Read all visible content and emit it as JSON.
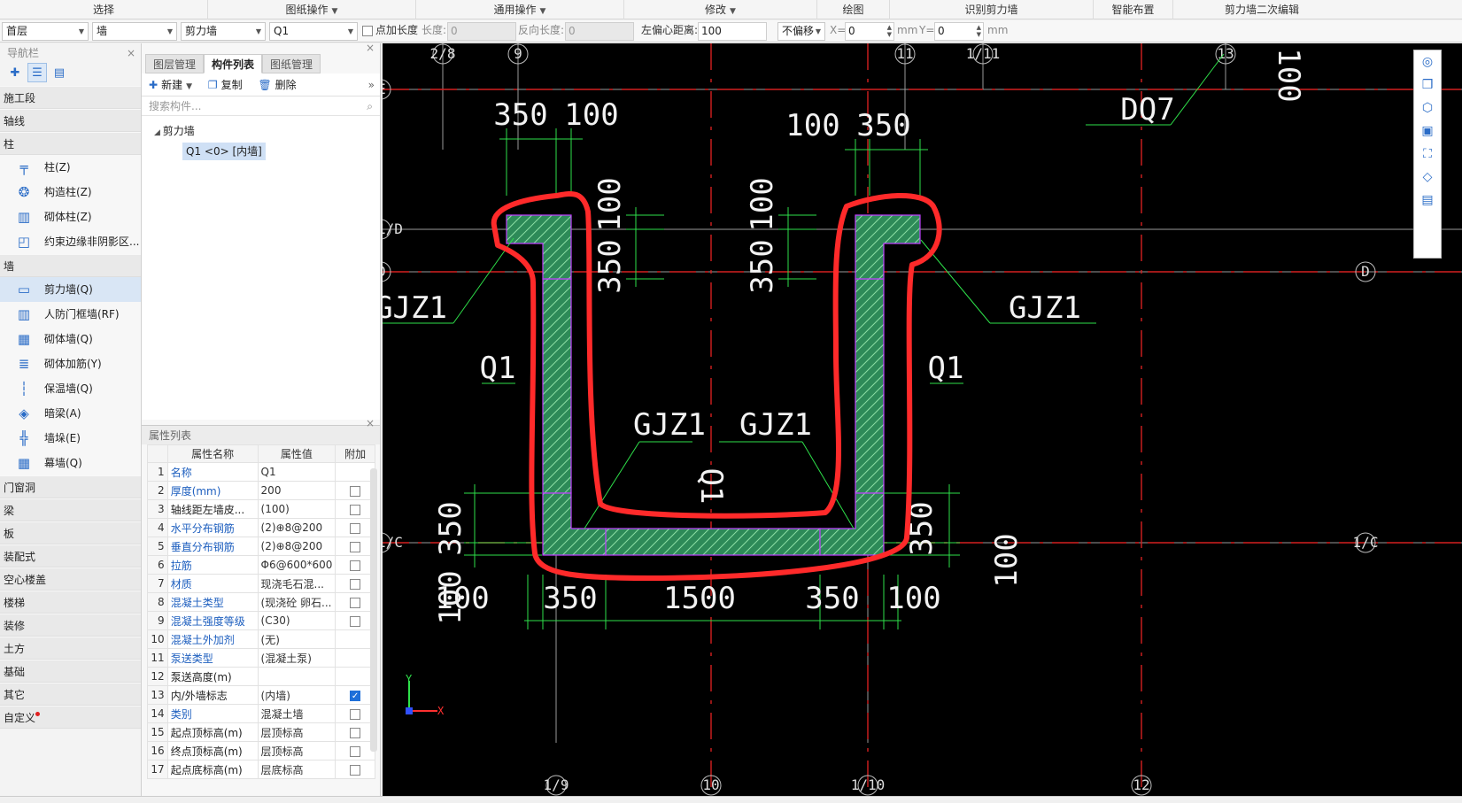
{
  "ribbon": {
    "groups": [
      {
        "label": "选择",
        "has_caret": false
      },
      {
        "label": "图纸操作",
        "has_caret": true
      },
      {
        "label": "通用操作",
        "has_caret": true
      },
      {
        "label": "修改",
        "has_caret": true
      },
      {
        "label": "绘图",
        "has_caret": false
      },
      {
        "label": "识别剪力墙",
        "has_caret": false
      },
      {
        "label": "智能布置",
        "has_caret": false
      },
      {
        "label": "剪力墙二次编辑",
        "has_caret": false
      }
    ]
  },
  "toolbar": {
    "floor": "首层",
    "category": "墙",
    "type": "剪力墙",
    "component": "Q1",
    "add_length_label": "点加长度",
    "length_label": "长度:",
    "length_value": "0",
    "reverse_length_label": "反向长度:",
    "reverse_length_value": "0",
    "offset_label": "左偏心距离:",
    "offset_value": "100",
    "shift_option": "不偏移",
    "x_label": "X=",
    "x_value": "0",
    "unit_mm": "mm",
    "y_label": "Y=",
    "y_value": "0"
  },
  "nav": {
    "title": "导航栏",
    "close": "×",
    "categories": {
      "construction": "施工段",
      "axis": "轴线",
      "column": "柱",
      "wall": "墙",
      "openings": "门窗洞",
      "beam": "梁",
      "slab": "板",
      "prefab": "装配式",
      "hollow": "空心楼盖",
      "stair": "楼梯",
      "decor": "装修",
      "earth": "土方",
      "foundation": "基础",
      "other": "其它",
      "custom": "自定义"
    },
    "column_items": [
      "柱(Z)",
      "构造柱(Z)",
      "砌体柱(Z)",
      "约束边缘非阴影区..."
    ],
    "wall_items": [
      "剪力墙(Q)",
      "人防门框墙(RF)",
      "砌体墙(Q)",
      "砌体加筋(Y)",
      "保温墙(Q)",
      "暗梁(A)",
      "墙垛(E)",
      "幕墙(Q)"
    ]
  },
  "mid": {
    "tabs": [
      "图层管理",
      "构件列表",
      "图纸管理"
    ],
    "actions": {
      "new": "新建",
      "copy": "复制",
      "delete": "删除"
    },
    "search_placeholder": "搜索构件...",
    "tree_root": "剪力墙",
    "tree_leaf": "Q1 <0> [内墙]",
    "props_title": "属性列表",
    "props_headers": {
      "name": "属性名称",
      "value": "属性值",
      "extra": "附加"
    },
    "props": [
      {
        "i": "1",
        "n": "名称",
        "v": "Q1",
        "blue": true,
        "cb": false,
        "show_cb": false
      },
      {
        "i": "2",
        "n": "厚度(mm)",
        "v": "200",
        "blue": true,
        "cb": false,
        "show_cb": true
      },
      {
        "i": "3",
        "n": "轴线距左墙皮...",
        "v": "(100)",
        "blue": false,
        "cb": false,
        "show_cb": true
      },
      {
        "i": "4",
        "n": "水平分布钢筋",
        "v": "(2)⊕8@200",
        "blue": true,
        "cb": false,
        "show_cb": true
      },
      {
        "i": "5",
        "n": "垂直分布钢筋",
        "v": "(2)⊕8@200",
        "blue": true,
        "cb": false,
        "show_cb": true
      },
      {
        "i": "6",
        "n": "拉筋",
        "v": "Φ6@600*600",
        "blue": true,
        "cb": false,
        "show_cb": true
      },
      {
        "i": "7",
        "n": "材质",
        "v": "现浇毛石混...",
        "blue": true,
        "cb": false,
        "show_cb": true
      },
      {
        "i": "8",
        "n": "混凝土类型",
        "v": "(现浇砼 卵石...",
        "blue": true,
        "cb": false,
        "show_cb": true
      },
      {
        "i": "9",
        "n": "混凝土强度等级",
        "v": "(C30)",
        "blue": true,
        "cb": false,
        "show_cb": true
      },
      {
        "i": "10",
        "n": "混凝土外加剂",
        "v": "(无)",
        "blue": true,
        "cb": false,
        "show_cb": false
      },
      {
        "i": "11",
        "n": "泵送类型",
        "v": "(混凝土泵)",
        "blue": true,
        "cb": false,
        "show_cb": false
      },
      {
        "i": "12",
        "n": "泵送高度(m)",
        "v": "",
        "blue": false,
        "cb": false,
        "show_cb": false
      },
      {
        "i": "13",
        "n": "内/外墙标志",
        "v": "(内墙)",
        "blue": false,
        "cb": true,
        "show_cb": true
      },
      {
        "i": "14",
        "n": "类别",
        "v": "混凝土墙",
        "blue": true,
        "cb": false,
        "show_cb": true
      },
      {
        "i": "15",
        "n": "起点顶标高(m)",
        "v": "层顶标高",
        "blue": false,
        "cb": false,
        "show_cb": true
      },
      {
        "i": "16",
        "n": "终点顶标高(m)",
        "v": "层顶标高",
        "blue": false,
        "cb": false,
        "show_cb": true
      },
      {
        "i": "17",
        "n": "起点底标高(m)",
        "v": "层底标高",
        "blue": false,
        "cb": false,
        "show_cb": true
      }
    ]
  },
  "drawing": {
    "axes_top": [
      "2/8",
      "9",
      "11",
      "1/11",
      "13"
    ],
    "axes_bottom": [
      "1/9",
      "10",
      "1/10",
      "12"
    ],
    "axes_left": [
      "E",
      "1/D",
      "D",
      "1/C"
    ],
    "axes_right": [
      "D",
      "1/C"
    ],
    "dims_top_left": [
      "350",
      "100"
    ],
    "dims_top_right": [
      "100",
      "350"
    ],
    "dims_bottom": [
      "100",
      "350",
      "1500",
      "350",
      "100"
    ],
    "dims_vertical": [
      "100",
      "350"
    ],
    "wall_labels": [
      "Q1",
      "Q1",
      "Q1"
    ],
    "column_labels": [
      "GJZ1",
      "GJZ1",
      "GJZ1",
      "GJZ1"
    ],
    "tag": "DQ7",
    "right_top_num": "100",
    "corner_x": "X",
    "corner_y": "Y"
  }
}
